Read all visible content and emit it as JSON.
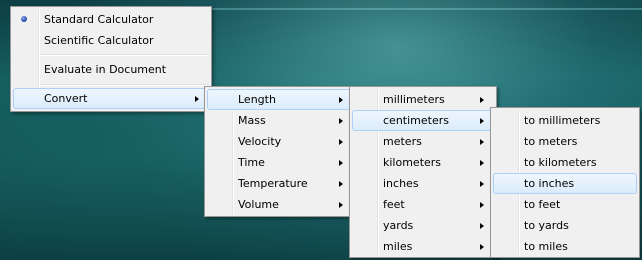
{
  "main_menu": {
    "standard": "Standard Calculator",
    "scientific": "Scientific Calculator",
    "evaluate": "Evaluate in Document",
    "convert": "Convert"
  },
  "convert_menu": [
    "Length",
    "Mass",
    "Velocity",
    "Time",
    "Temperature",
    "Volume"
  ],
  "length_menu": [
    "millimeters",
    "centimeters",
    "meters",
    "kilometers",
    "inches",
    "feet",
    "yards",
    "miles"
  ],
  "centimeters_menu": [
    "to millimeters",
    "to meters",
    "to kilometers",
    "to inches",
    "to feet",
    "to yards",
    "to miles"
  ]
}
